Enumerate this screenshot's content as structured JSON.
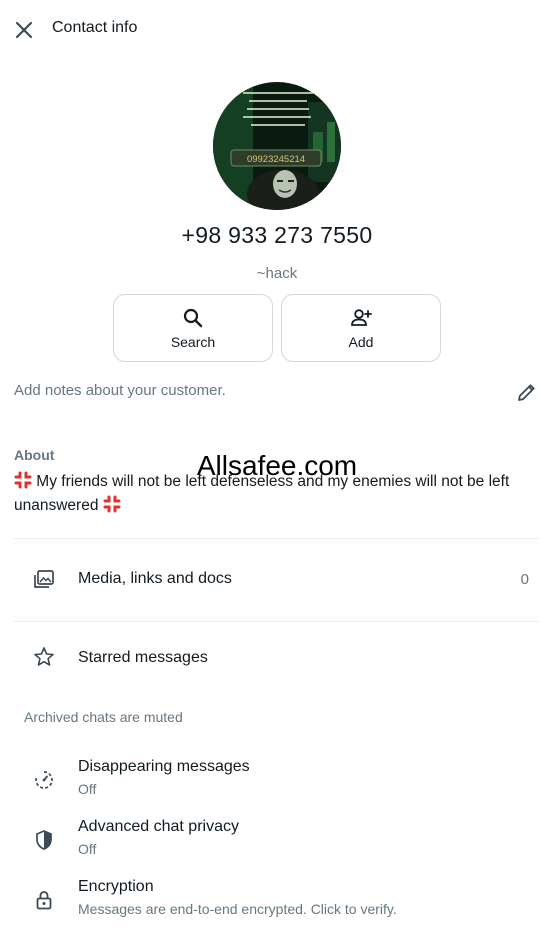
{
  "header": {
    "title": "Contact info",
    "close_icon": "close-icon"
  },
  "profile": {
    "phone": "+98 933 273 7550",
    "alias": "~hack",
    "avatar_caption": "09923245214"
  },
  "actions": [
    {
      "label": "Search",
      "icon": "search-icon"
    },
    {
      "label": "Add",
      "icon": "add-user-icon"
    }
  ],
  "notes": {
    "placeholder": "Add notes about your customer.",
    "icon": "pencil-icon"
  },
  "about": {
    "label": "About",
    "text": " My friends will not be left defenseless and my enemies will not be left unanswered "
  },
  "watermark": "Allsafee.com",
  "media": {
    "title": "Media, links and docs",
    "count": "0"
  },
  "starred": {
    "title": "Starred messages"
  },
  "archived_note": "Archived chats are muted",
  "disappearing": {
    "title": "Disappearing messages",
    "status": "Off"
  },
  "privacy": {
    "title": "Advanced chat privacy",
    "status": "Off"
  },
  "encryption": {
    "title": "Encryption",
    "subtitle": "Messages are end-to-end encrypted. Click to verify."
  },
  "colors": {
    "primary_text": "#111b21",
    "secondary_text": "#667781",
    "divider": "#e9edef",
    "anger_red": "#e0312b"
  }
}
